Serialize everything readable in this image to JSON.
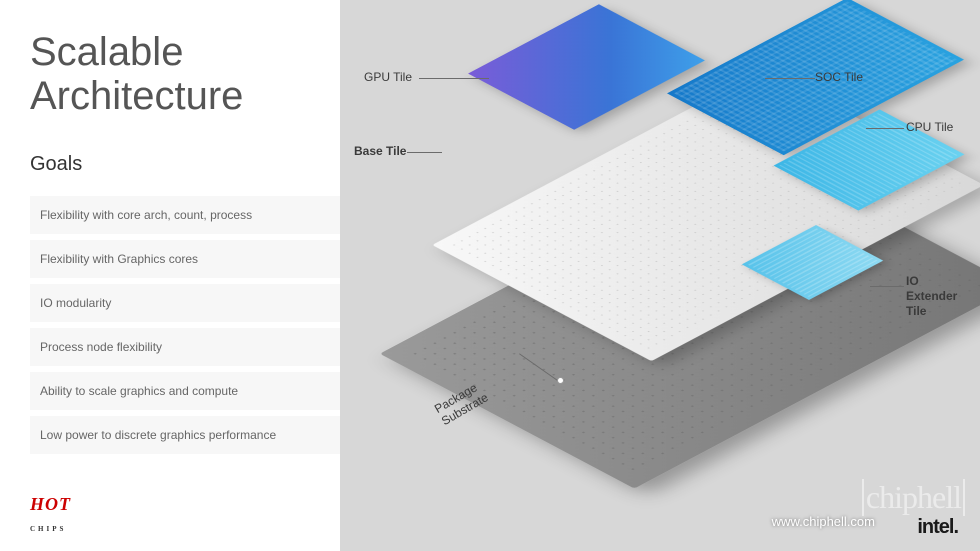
{
  "title_line1": "Scalable",
  "title_line2": "Architecture",
  "goals_heading": "Goals",
  "goals": [
    "Flexibility with core arch, count, process",
    "Flexibility with Graphics cores",
    "IO modularity",
    "Process node flexibility",
    "Ability to scale graphics and compute",
    "Low power to discrete graphics performance"
  ],
  "labels": {
    "gpu": "GPU Tile",
    "soc": "SOC Tile",
    "cpu": "CPU Tile",
    "base": "Base Tile",
    "io_l1": "IO",
    "io_l2": "Extender",
    "io_l3": "Tile",
    "pkg_l1": "Package",
    "pkg_l2": "Substrate"
  },
  "footer": {
    "hot": "HOT",
    "hot_sub": "CHIPS",
    "intel": "intel.",
    "url": "www.chiphell.com",
    "chiphell": "chiphell"
  }
}
